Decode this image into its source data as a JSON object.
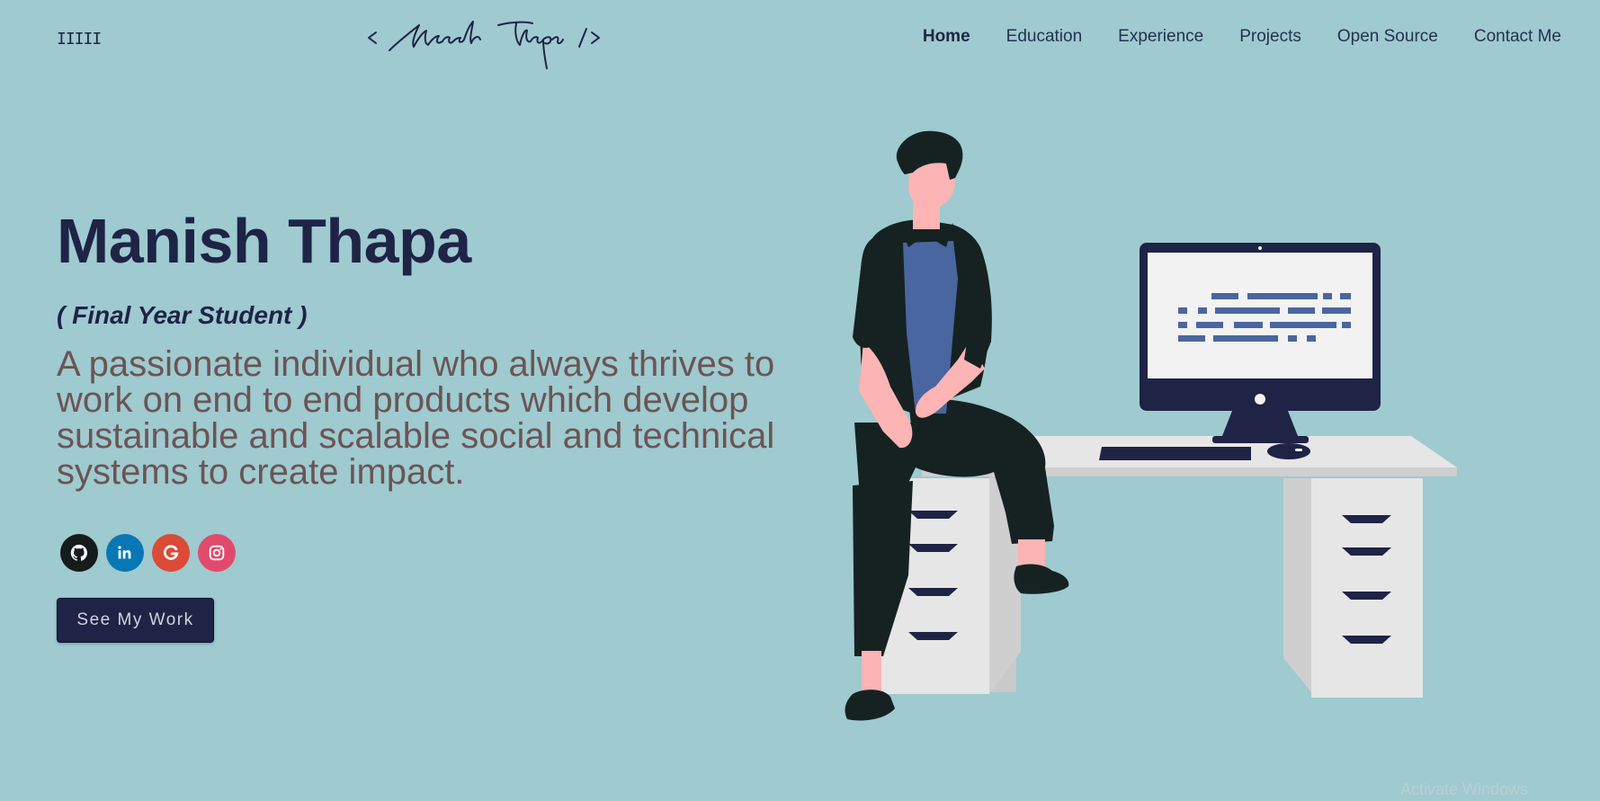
{
  "header": {
    "menu_icon": "IIIII",
    "logo_text": "< Manish Thapa />",
    "nav": [
      {
        "label": "Home",
        "active": true
      },
      {
        "label": "Education",
        "active": false
      },
      {
        "label": "Experience",
        "active": false
      },
      {
        "label": "Projects",
        "active": false
      },
      {
        "label": "Open Source",
        "active": false
      },
      {
        "label": "Contact Me",
        "active": false
      }
    ]
  },
  "hero": {
    "name": "Manish Thapa",
    "subtitle": "( Final Year Student )",
    "description": "A passionate individual who always thrives to work on end to end products which develop sustainable and scalable social and technical systems to create impact.",
    "cta_label": "See My Work"
  },
  "socials": [
    {
      "icon": "github-icon",
      "color": "#161b1b"
    },
    {
      "icon": "linkedin-icon",
      "color": "#0a77b5"
    },
    {
      "icon": "google-icon",
      "color": "#dc4a38"
    },
    {
      "icon": "instagram-icon",
      "color": "#e24a6d"
    }
  ],
  "colors": {
    "background": "#9ecad0",
    "primary": "#1f2346",
    "description_text": "#6b5553",
    "desk": "#e6e6e6",
    "monitor": "#1f2346",
    "shirt": "#4a66a0",
    "clothes": "#162221"
  },
  "system": {
    "watermark": "Activate Windows"
  }
}
